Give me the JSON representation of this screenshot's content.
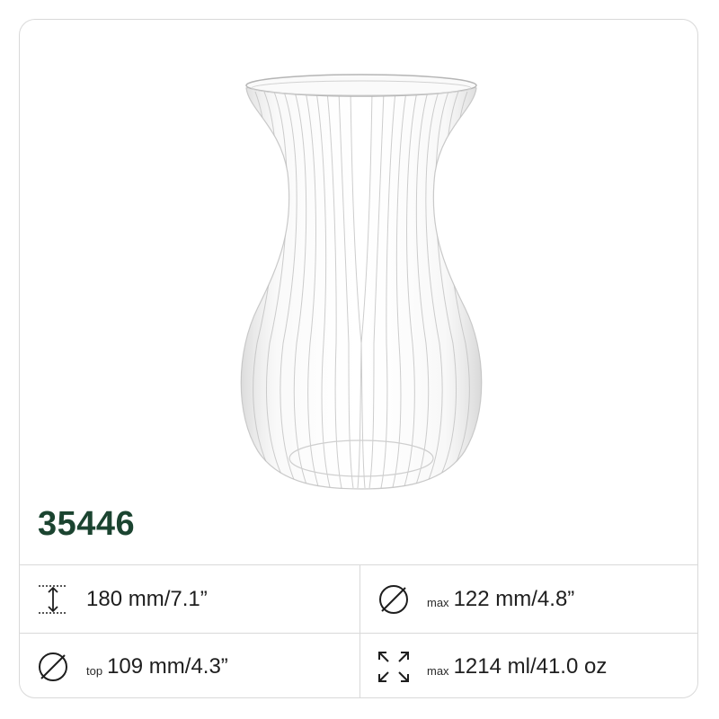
{
  "product": {
    "code": "35446",
    "image_icon": "glass-vase-image"
  },
  "specs": {
    "height": {
      "icon": "height-icon",
      "prefix": "",
      "value": "180 mm/7.1”"
    },
    "max_diameter": {
      "icon": "diameter-icon",
      "prefix": "max",
      "value": "122 mm/4.8”"
    },
    "top_diameter": {
      "icon": "diameter-icon",
      "prefix": "top",
      "value": "109 mm/4.3”"
    },
    "capacity": {
      "icon": "volume-expand-icon",
      "prefix": "max",
      "value": "1214 ml/41.0 oz"
    }
  },
  "colors": {
    "code": "#1b4430",
    "border": "#d9d9d9",
    "text": "#1e1e1e"
  }
}
